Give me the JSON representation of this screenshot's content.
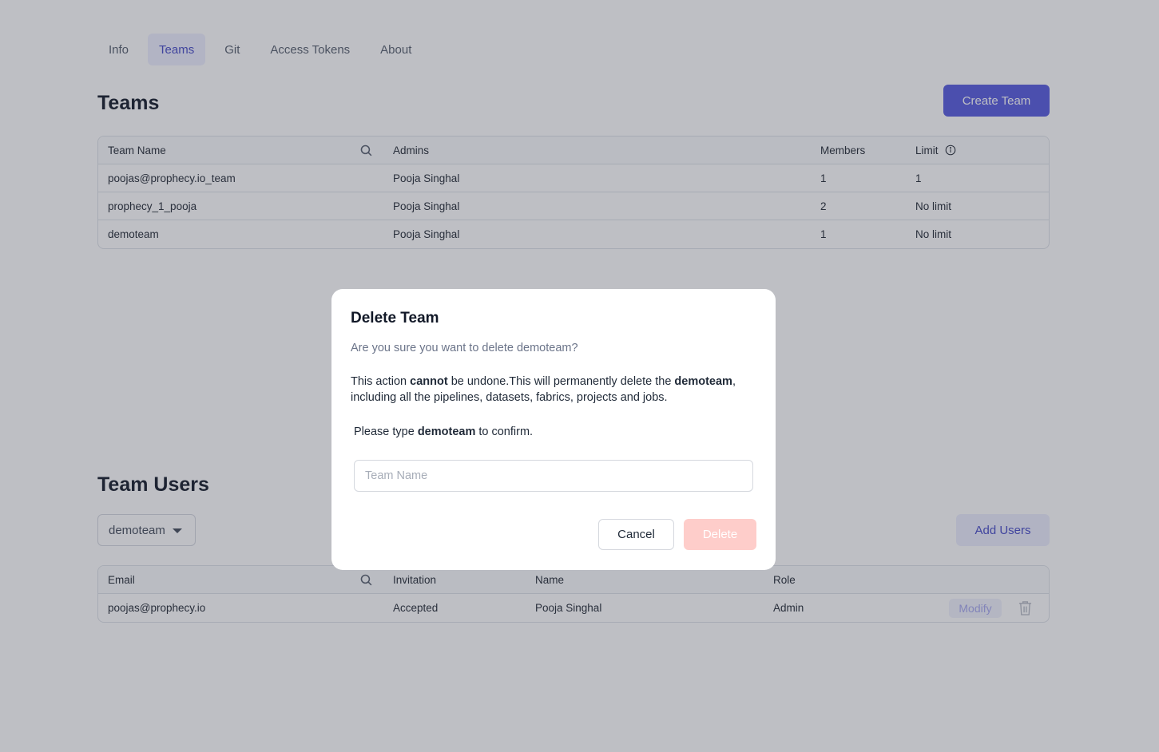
{
  "tabs": [
    {
      "label": "Info",
      "active": false
    },
    {
      "label": "Teams",
      "active": true
    },
    {
      "label": "Git",
      "active": false
    },
    {
      "label": "Access Tokens",
      "active": false
    },
    {
      "label": "About",
      "active": false
    }
  ],
  "teams": {
    "title": "Teams",
    "create_button": "Create Team",
    "columns": [
      "Team Name",
      "Admins",
      "Members",
      "Limit"
    ],
    "rows": [
      {
        "name": "poojas@prophecy.io_team",
        "admins": "Pooja Singhal",
        "members": "1",
        "limit": "1"
      },
      {
        "name": "prophecy_1_pooja",
        "admins": "Pooja Singhal",
        "members": "2",
        "limit": "No limit"
      },
      {
        "name": "demoteam",
        "admins": "Pooja Singhal",
        "members": "1",
        "limit": "No limit"
      }
    ]
  },
  "team_users": {
    "title": "Team Users",
    "selected_team": "demoteam",
    "add_button": "Add Users",
    "columns": [
      "Email",
      "Invitation",
      "Name",
      "Role"
    ],
    "rows": [
      {
        "email": "poojas@prophecy.io",
        "invitation": "Accepted",
        "name": "Pooja Singhal",
        "role": "Admin",
        "modify_label": "Modify"
      }
    ]
  },
  "modal": {
    "title": "Delete Team",
    "subtitle": "Are you sure you want to delete demoteam?",
    "body_1": "This action ",
    "body_bold_1": "cannot",
    "body_2": " be undone.This will permanently delete the ",
    "body_bold_2": "demoteam",
    "body_3": ", including all the pipelines, datasets, fabrics, projects and jobs.",
    "confirm_1": "Please type ",
    "confirm_bold": "demoteam",
    "confirm_2": " to confirm.",
    "input_placeholder": "Team Name",
    "input_value": "",
    "cancel_label": "Cancel",
    "delete_label": "Delete"
  },
  "colors": {
    "accent": "#5b5fe0",
    "danger_disabled": "#fecdca"
  }
}
